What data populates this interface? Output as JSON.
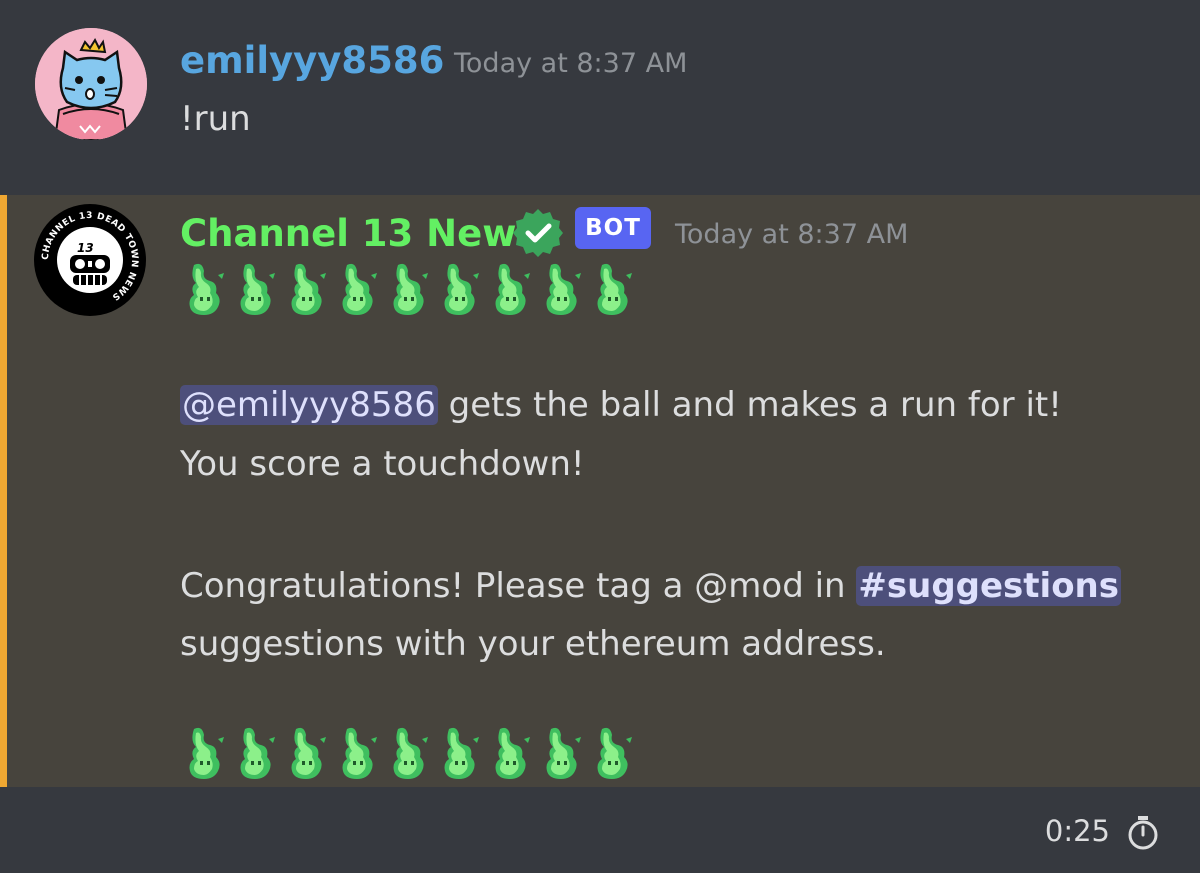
{
  "messages": [
    {
      "author": "emilyyy8586",
      "timestamp": "Today at 8:37 AM",
      "text": "!run",
      "avatar": "pink-cat-with-crown-avatar",
      "name_color": "#58a6e0"
    },
    {
      "author": "Channel 13 News",
      "badge": "BOT",
      "verified": true,
      "timestamp": "Today at 8:37 AM",
      "avatar": "channel-13-dead-town-news-logo",
      "avatar_text": "CHANNEL 13 DEAD TOWN NEWS",
      "avatar_number": "13",
      "name_color": "#63f063",
      "emoji_row_top": {
        "emoji": "green-flame-ghost",
        "count": 9
      },
      "mention": "@emilyyy8586",
      "line1_rest": " gets the ball and makes a run for it!",
      "line2": "You score a touchdown!",
      "line3_prefix": "Congratulations! Please tag a @mod in ",
      "channel_link": "#suggestions",
      "line4": "suggestions with your ethereum address.",
      "emoji_row_bottom": {
        "emoji": "green-flame-ghost",
        "count": 9
      }
    }
  ],
  "bottom_bar": {
    "timer": "0:25",
    "icon": "stopwatch-icon"
  },
  "colors": {
    "background": "#36393f",
    "highlight_background": "#47443d",
    "highlight_bar": "#f0a832",
    "bot_tag": "#5865f2",
    "mention_bg": "#5865f2"
  }
}
